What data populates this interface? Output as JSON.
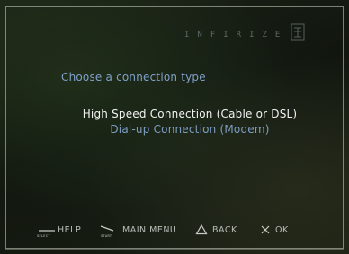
{
  "logo": {
    "text": "INFIRIZE"
  },
  "prompt": "Choose a connection type",
  "options": [
    {
      "label": "High Speed Connection (Cable or DSL)",
      "selected": true
    },
    {
      "label": "Dial-up Connection (Modem)",
      "selected": false
    }
  ],
  "footer": {
    "select_tag": "SELECT",
    "help": "HELP",
    "start_tag": "START",
    "main_menu": "MAIN MENU",
    "back": "BACK",
    "ok": "OK"
  },
  "colors": {
    "selected_text": "#f2f2f2",
    "unselected_text": "#7d9dc3",
    "prompt_text": "#7fa0c8"
  },
  "icons": {
    "select": "select-button-icon",
    "start": "start-button-icon",
    "back": "triangle-icon",
    "ok": "cross-icon"
  }
}
